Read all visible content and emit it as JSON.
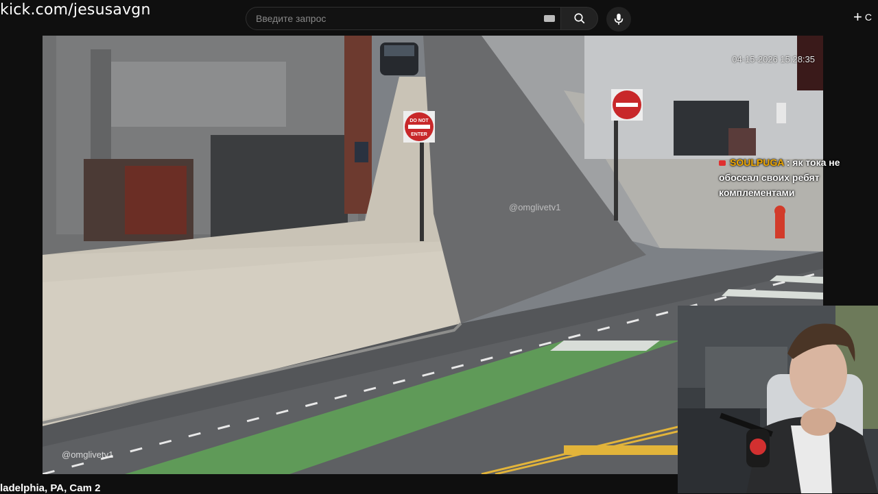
{
  "header": {
    "url_text": "kick.com/jesusavgn",
    "search_placeholder": "Введите запрос",
    "create_label": "С"
  },
  "video": {
    "timestamp": "04-15-2026 15:28:35",
    "watermark_top": "@omglivetv1",
    "watermark_bottom": "@omglivetv1",
    "sign_text_1": "DO NOT",
    "sign_text_2": "ENTER",
    "chat": {
      "username": "SOULPUGA",
      "separator": ":",
      "message": "як тока не обоссал своих ребят комплементами"
    }
  },
  "caption": "ladelphia, PA, Cam 2",
  "colors": {
    "background": "#0f0f0f",
    "bike_lane": "#5f9a58",
    "chat_username": "#f0a800",
    "sign_red": "#c8282a"
  },
  "icons": [
    "search-icon",
    "microphone-icon",
    "keyboard-icon",
    "plus-icon"
  ]
}
